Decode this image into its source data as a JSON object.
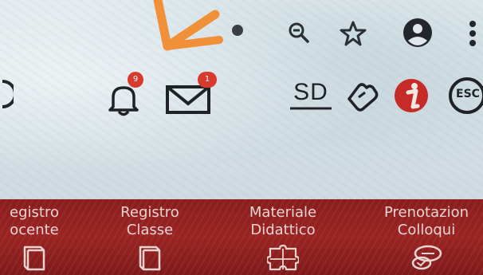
{
  "toolbar": {
    "icons": [
      "search-zoom-icon",
      "star-icon",
      "account-icon",
      "more-icon"
    ]
  },
  "header": {
    "notifications_count": "9",
    "messages_count": "1",
    "sd_logo_text": "SD",
    "esc_text": "ESC"
  },
  "nav": {
    "items": [
      {
        "line1": "egistro",
        "line2": "ocente",
        "icon": "book-icon"
      },
      {
        "line1": "Registro",
        "line2": "Classe",
        "icon": "book-icon"
      },
      {
        "line1": "Materiale",
        "line2": "Didattico",
        "icon": "puzzle-icon"
      },
      {
        "line1": "Prenotazion",
        "line2": "Colloqui",
        "icon": "chat-bubbles-icon"
      }
    ]
  },
  "colors": {
    "nav_background": "#8a1d1d",
    "nav_text": "#ead4d2",
    "badge": "#d83a2e",
    "annotation_arrow": "#f0913a"
  }
}
